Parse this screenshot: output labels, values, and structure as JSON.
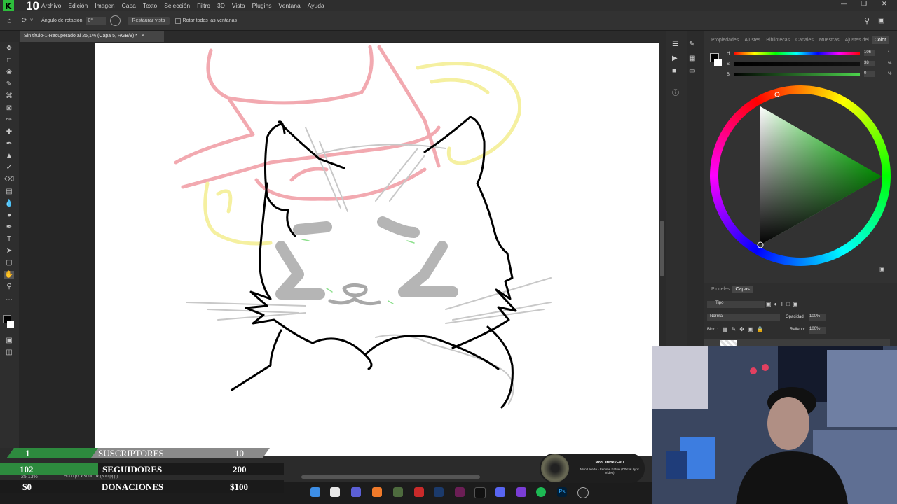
{
  "menu": {
    "logo_text": "10",
    "items": [
      "Archivo",
      "Edición",
      "Imagen",
      "Capa",
      "Texto",
      "Selección",
      "Filtro",
      "3D",
      "Vista",
      "Plugins",
      "Ventana",
      "Ayuda"
    ]
  },
  "options": {
    "rotation_label": "Ángulo de rotación:",
    "rotation_value": "0°",
    "reset_view": "Restaurar vista",
    "rotate_all": "Rotar todas las ventanas"
  },
  "document": {
    "tab_title": "Sin título-1-Recuperado al 25,1% (Capa 5, RGB/8) *",
    "close": "×"
  },
  "status": {
    "zoom": "25,13%",
    "size": "5000 px x 5000 px (300 ppp)"
  },
  "color_panel": {
    "tabs": [
      "Propiedades",
      "Ajustes",
      "Bibliotecas",
      "Canales",
      "Muestras",
      "Ajustes del",
      "Color"
    ],
    "active_tab": "Color",
    "sliders": [
      {
        "label": "H",
        "value": "106",
        "unit": "°"
      },
      {
        "label": "S",
        "value": "38",
        "unit": "%"
      },
      {
        "label": "B",
        "value": "0",
        "unit": "%"
      }
    ]
  },
  "layers_panel": {
    "tabs": [
      "Pinceles",
      "Capas"
    ],
    "active_tab": "Capas",
    "filter": "Tipo",
    "blend_mode": "Normal",
    "opacity_label": "Opacidad:",
    "opacity_value": "100%",
    "lock_label": "Bloq.:",
    "fill_label": "Relleno:",
    "fill_value": "100%"
  },
  "overlay": {
    "subs_count": "1",
    "subs_label": "SUSCRIPTORES",
    "subs_goal": "10",
    "followers_count": "102",
    "followers_label": "SEGUIDORES",
    "followers_goal": "200",
    "donations_count": "$0",
    "donations_label": "DONACIONES",
    "donations_goal": "$100",
    "followers_progress": 0.51
  },
  "music": {
    "artist": "MonLaferteVEVO",
    "title": "Mon Laferte - Femme Fatale (Official Lyric Video)"
  },
  "colors": {
    "accent_green": "#2d8a3e",
    "sketch_pink": "#f2a9b0",
    "sketch_yellow": "#f5f0a0"
  }
}
